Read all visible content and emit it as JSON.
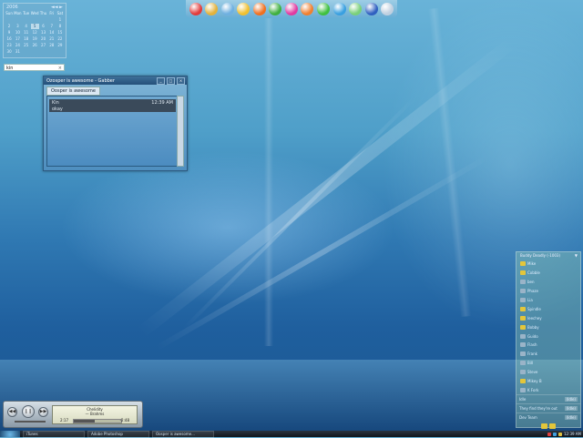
{
  "calendar": {
    "year": "2006",
    "nav": "◄◄ ►",
    "weekdays": [
      "Sun",
      "Mon",
      "Tue",
      "Wed",
      "Thu",
      "Fri",
      "Sat"
    ],
    "days": [
      "",
      "",
      "",
      "",
      "",
      "",
      "1",
      "2",
      "3",
      "4",
      "5",
      "6",
      "7",
      "8",
      "9",
      "10",
      "11",
      "12",
      "13",
      "14",
      "15",
      "16",
      "17",
      "18",
      "19",
      "20",
      "21",
      "22",
      "23",
      "24",
      "25",
      "26",
      "27",
      "28",
      "29",
      "30",
      "31",
      "",
      "",
      "",
      "",
      "",
      ""
    ],
    "today": "5"
  },
  "clipbox": {
    "value": "kin",
    "close": "×"
  },
  "dock": {
    "icons": [
      {
        "name": "lifering-icon",
        "color": "#e23c3c"
      },
      {
        "name": "chain-icon",
        "color": "#e2b23c"
      },
      {
        "name": "wrench-icon",
        "color": "#6fb0e0"
      },
      {
        "name": "runner-icon",
        "color": "#f0c030"
      },
      {
        "name": "x-icon",
        "color": "#f07020"
      },
      {
        "name": "gear-icon",
        "color": "#40b040"
      },
      {
        "name": "flower-icon",
        "color": "#e03aa0"
      },
      {
        "name": "firefox-icon",
        "color": "#f08030"
      },
      {
        "name": "chat-icon",
        "color": "#40c040"
      },
      {
        "name": "globe-icon",
        "color": "#3aa0e0"
      },
      {
        "name": "music-icon",
        "color": "#7ad07a"
      },
      {
        "name": "media-icon",
        "color": "#3060c0"
      },
      {
        "name": "recycle-icon",
        "color": "#c0d0e0"
      }
    ]
  },
  "chat": {
    "window_title": "Ozosper is awesome - Gabber",
    "minimize": "_",
    "maximize": "□",
    "close": "×",
    "tab_label": "Oosper is awesome",
    "message": {
      "from": "Kin",
      "time": "12:39 AM",
      "body": "okay"
    }
  },
  "roster": {
    "title": "Buddy Deadly (-1003)",
    "arrow": "▼",
    "contacts": [
      {
        "name": "Mike",
        "color": "#e3c63a"
      },
      {
        "name": "Cobble",
        "color": "#e3c63a"
      },
      {
        "name": "ben",
        "color": "#9ab4c8"
      },
      {
        "name": "Phaze",
        "color": "#9ab4c8"
      },
      {
        "name": "Lia",
        "color": "#9ab4c8"
      },
      {
        "name": "Spindle",
        "color": "#e3c63a"
      },
      {
        "name": "leechey",
        "color": "#e3c63a"
      },
      {
        "name": "Bobby",
        "color": "#e3c63a"
      },
      {
        "name": "Guido",
        "color": "#9ab4c8"
      },
      {
        "name": "Flash",
        "color": "#9ab4c8"
      },
      {
        "name": "Frank",
        "color": "#9ab4c8"
      },
      {
        "name": "Bill",
        "color": "#9ab4c8"
      },
      {
        "name": "Steve",
        "color": "#9ab4c8"
      },
      {
        "name": "Mikey B",
        "color": "#e3c63a"
      },
      {
        "name": "K Fork",
        "color": "#9ab4c8"
      }
    ],
    "status_lines": [
      {
        "label": "Idle",
        "value": "(Idle)"
      },
      {
        "label": "They find they're out",
        "value": "(Idle)"
      },
      {
        "label": "Dev Team",
        "value": "(Idle)"
      }
    ]
  },
  "player": {
    "prev": "◀◀",
    "pause": "❙❙",
    "next": "▶▶",
    "track": "Chelidity",
    "separator": "—",
    "artist": "Brahms",
    "elapsed": "2:17",
    "remaining": "-2:48",
    "progress": 0.45
  },
  "taskbar": {
    "tasks": [
      "iTunes",
      "Adobe Photoshop",
      "Oosper is awesome..."
    ],
    "clock": "12:39 AM"
  }
}
